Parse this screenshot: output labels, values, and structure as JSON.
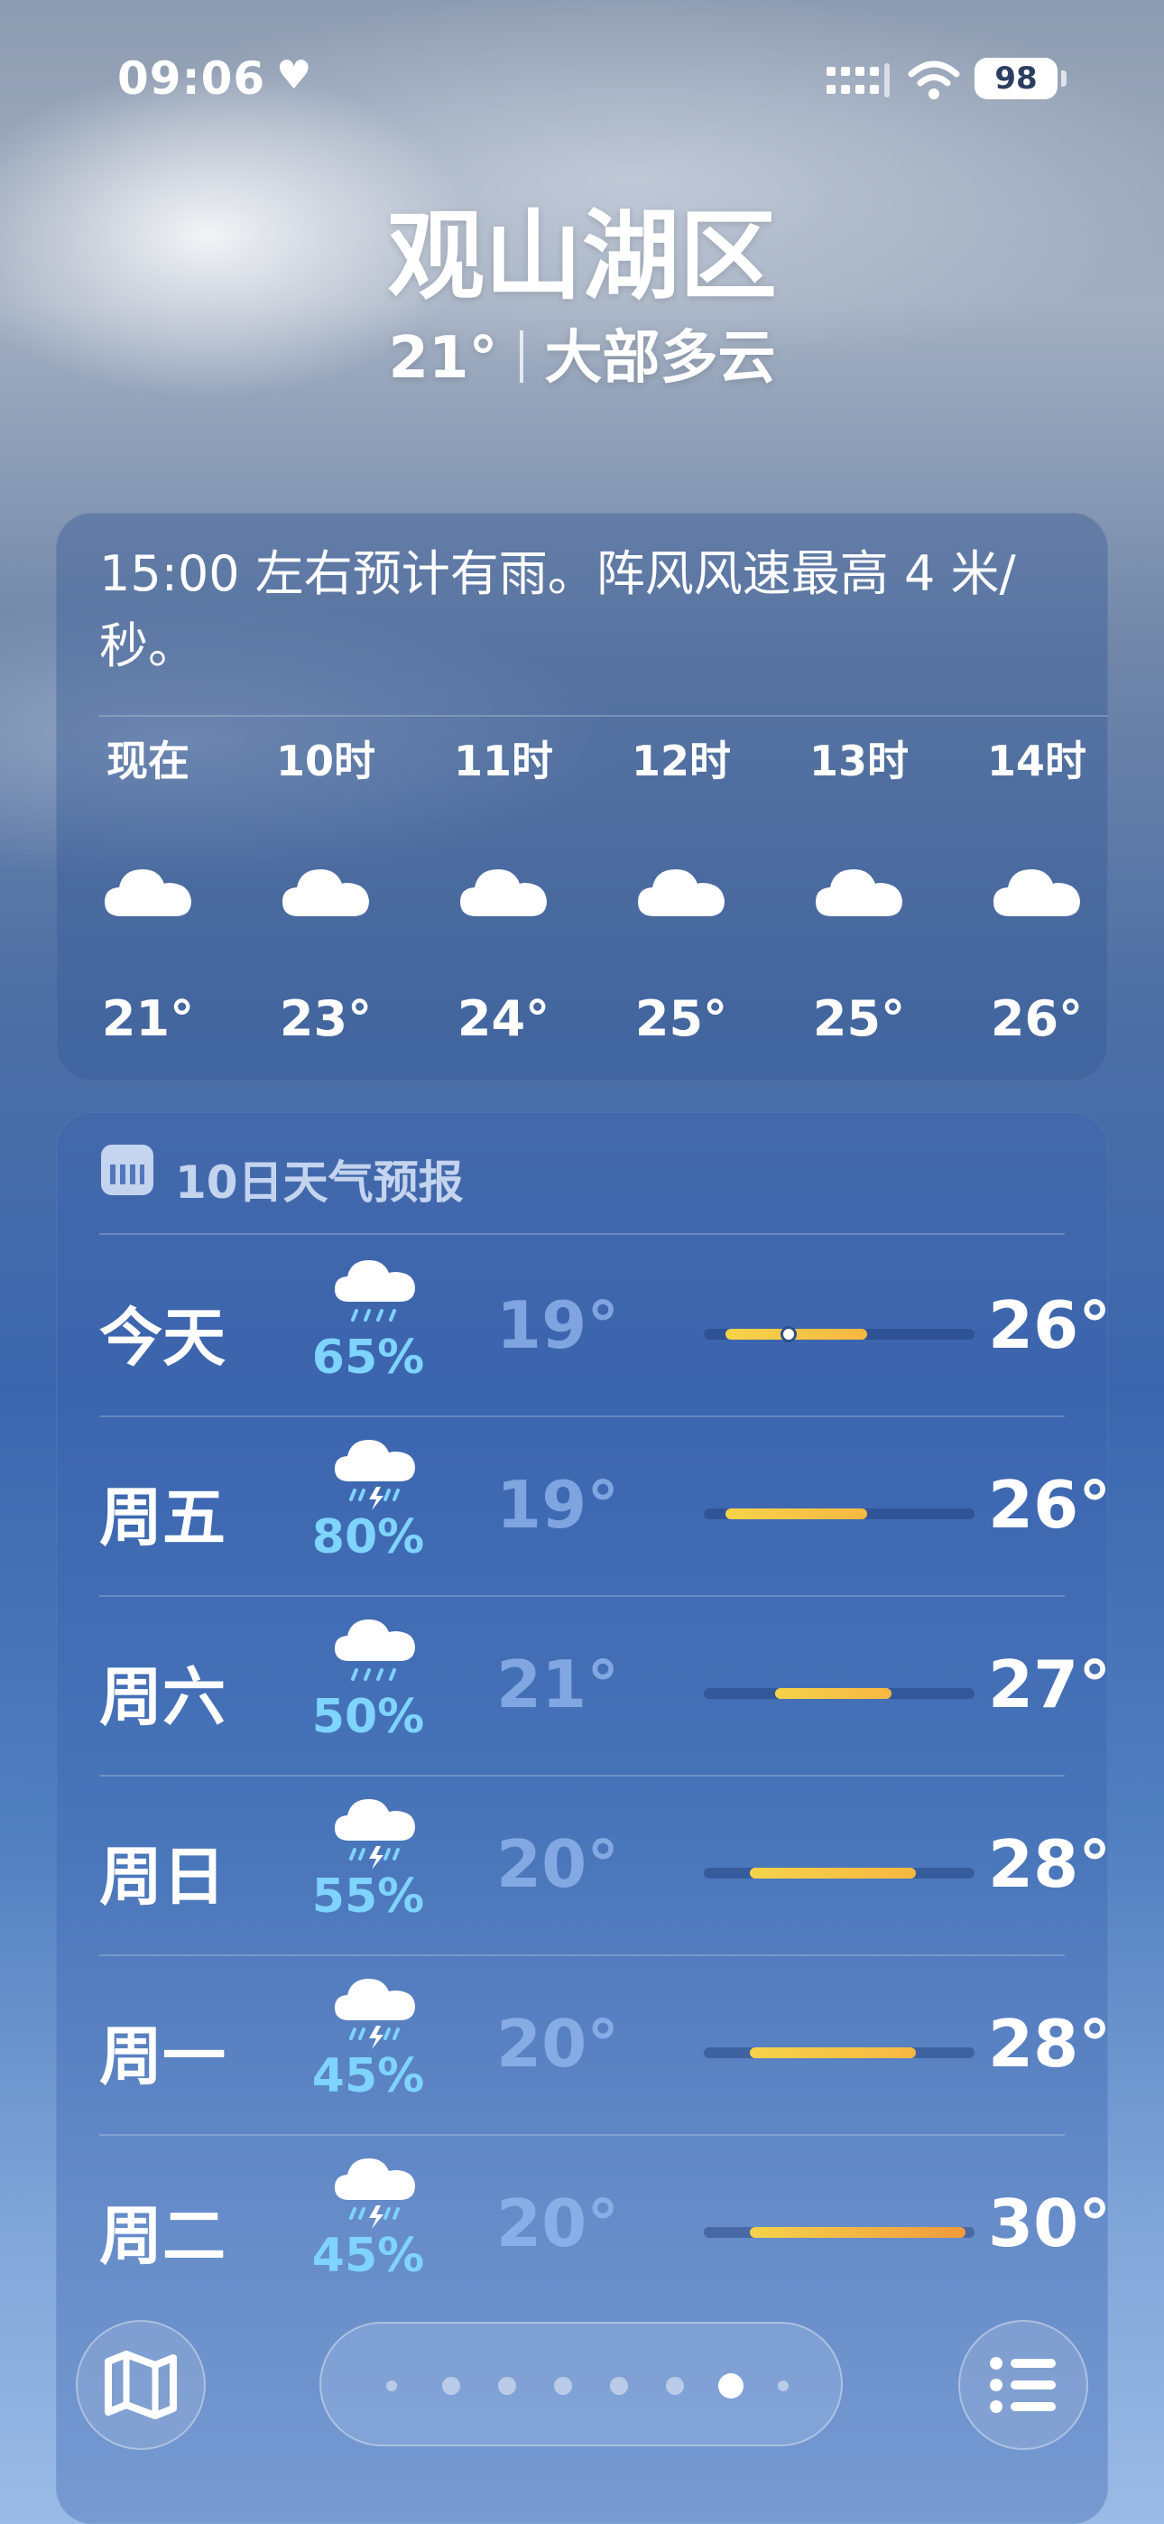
{
  "status_bar": {
    "time": "09:06",
    "heart": "♥",
    "battery": "98",
    "icons": [
      "cellular-signal-icon",
      "wifi-icon",
      "battery-icon"
    ]
  },
  "header": {
    "city": "观山湖区",
    "current_temp": "21°",
    "condition": "大部多云"
  },
  "hourly": {
    "summary": "15:00 左右预计有雨。阵风风速最高 4 米/秒。",
    "hours": [
      {
        "label": "现在",
        "icon": "cloud-icon",
        "temp": "21°"
      },
      {
        "label": "10时",
        "icon": "cloud-icon",
        "temp": "23°"
      },
      {
        "label": "11时",
        "icon": "cloud-icon",
        "temp": "24°"
      },
      {
        "label": "12时",
        "icon": "cloud-icon",
        "temp": "25°"
      },
      {
        "label": "13时",
        "icon": "cloud-icon",
        "temp": "25°"
      },
      {
        "label": "14时",
        "icon": "cloud-icon",
        "temp": "26°"
      }
    ]
  },
  "daily": {
    "title": "10日天气预报",
    "range_min": 19,
    "range_max": 30,
    "days": [
      {
        "name": "今天",
        "icon": "cloud-rain-icon",
        "pct": "65%",
        "low": "19°",
        "high": "26°",
        "low_val": 19,
        "high_val": 26,
        "current": 21
      },
      {
        "name": "周五",
        "icon": "cloud-bolt-rain-icon",
        "pct": "80%",
        "low": "19°",
        "high": "26°",
        "low_val": 19,
        "high_val": 26
      },
      {
        "name": "周六",
        "icon": "cloud-rain-icon",
        "pct": "50%",
        "low": "21°",
        "high": "27°",
        "low_val": 21,
        "high_val": 27
      },
      {
        "name": "周日",
        "icon": "cloud-bolt-rain-icon",
        "pct": "55%",
        "low": "20°",
        "high": "28°",
        "low_val": 20,
        "high_val": 28
      },
      {
        "name": "周一",
        "icon": "cloud-bolt-rain-icon",
        "pct": "45%",
        "low": "20°",
        "high": "28°",
        "low_val": 20,
        "high_val": 28
      },
      {
        "name": "周二",
        "icon": "cloud-bolt-rain-icon",
        "pct": "45%",
        "low": "20°",
        "high": "30°",
        "low_val": 20,
        "high_val": 30
      }
    ]
  },
  "bottom_bar": {
    "left_icon": "map-icon",
    "right_icon": "list-icon",
    "pages": 8,
    "active_page": 6
  }
}
